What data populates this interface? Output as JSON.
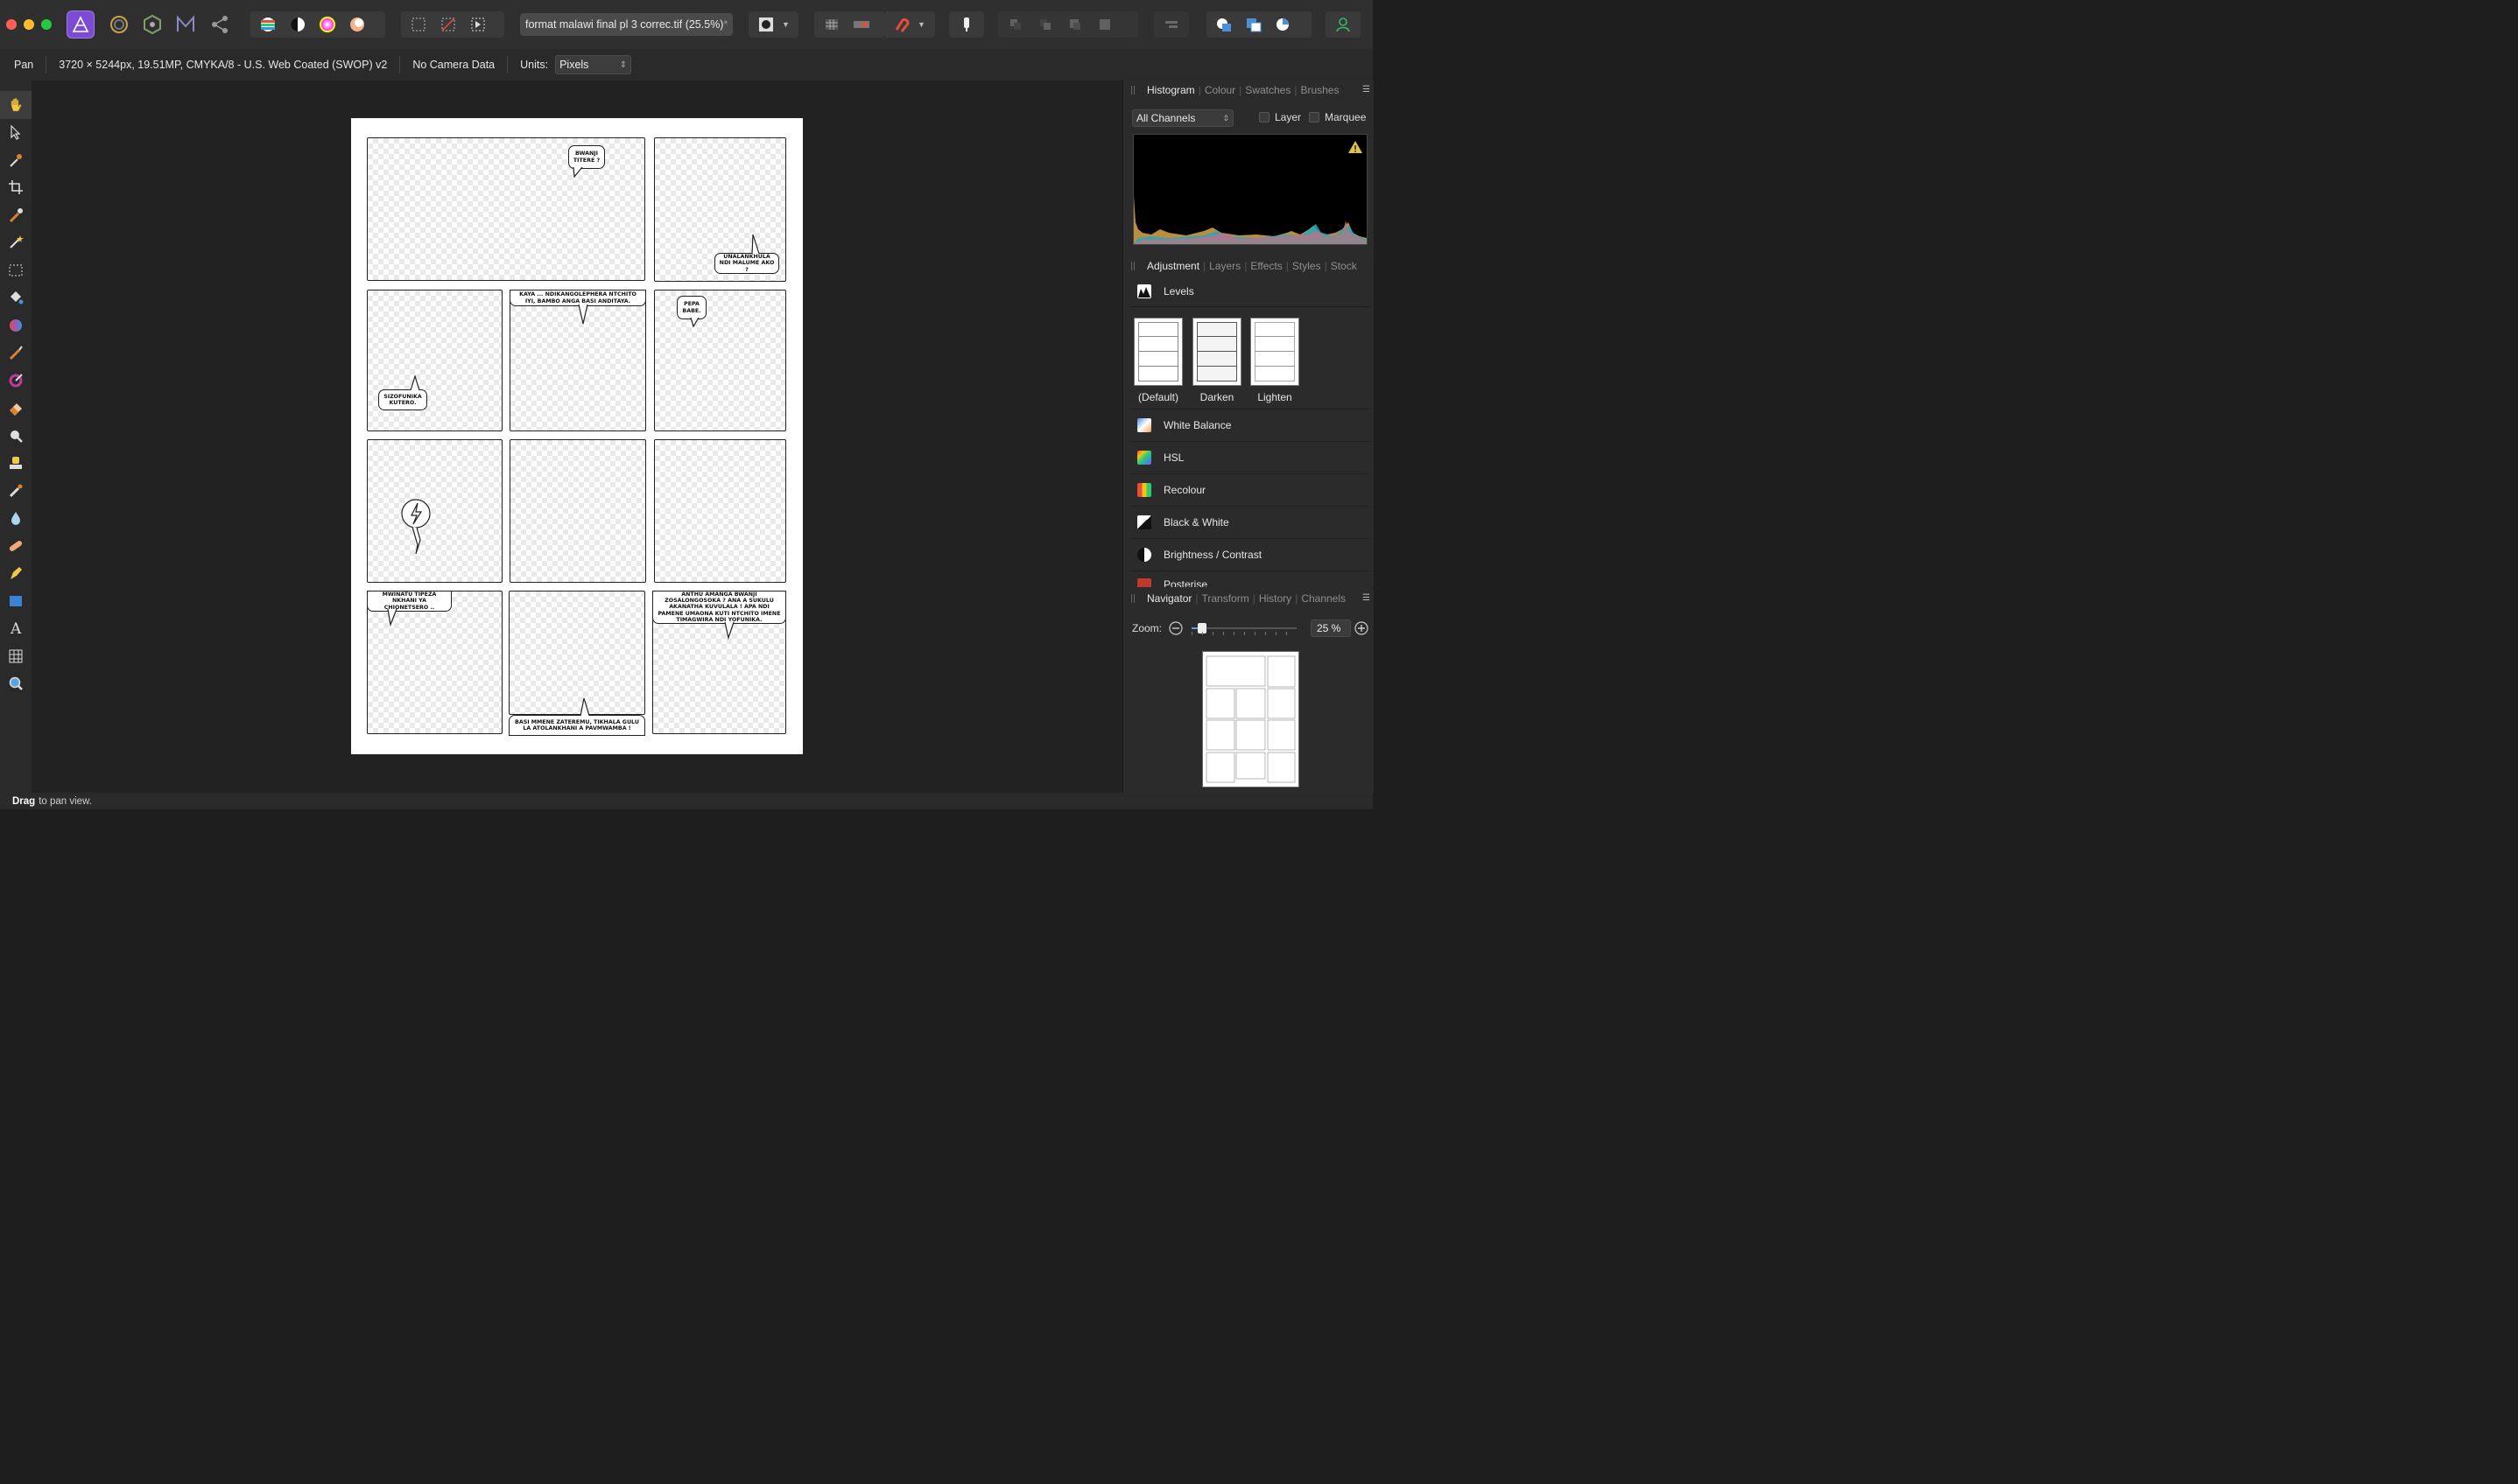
{
  "toolbar": {
    "document_tab": "format malawi final pl 3 correc.tif (25.5%)",
    "document_modified_mark": "*"
  },
  "contextbar": {
    "tool_name": "Pan",
    "doc_info": "3720 × 5244px, 19.51MP, CMYKA/8 - U.S. Web Coated (SWOP) v2",
    "camera": "No Camera Data",
    "units_label": "Units:",
    "units_value": "Pixels"
  },
  "comic": {
    "bubble1": "BWANJI TITERE ?",
    "bubble2": "UNALANKHULA NDI MALUME AKO ?",
    "bubble3": "KAYA ... NDIKANGOLEPHERA NTCHITO IYI, BAMBO ANGA BASI ANDITAYA.",
    "bubble4": "PEPA BABE.",
    "bubble5": "SIZOFUNIKA KUTERO.",
    "bubble6": "MWINATU TIPEZA NKHANI YA CHIONETSERO ..",
    "bubble7": "ANTHU AMANGA BWANJI ZOSALONGOSOKA ? ANA A SUKULU AKANATHA KUVULALA ! APA NDI PAMENE UMAONA KUTI NTCHITO IMENE TIMAGWIRA NDI YOFUNIKA.",
    "bubble8": "BASI MMENE ZATEREMU, TIKHALA GULU LA ATOLANKHANI A PAVMWAMBA !"
  },
  "histogram_panel": {
    "tabs": [
      "Histogram",
      "Colour",
      "Swatches",
      "Brushes"
    ],
    "channels_value": "All Channels",
    "layer_label": "Layer",
    "marquee_label": "Marquee"
  },
  "adjustment_panel": {
    "tabs": [
      "Adjustment",
      "Layers",
      "Effects",
      "Styles",
      "Stock"
    ],
    "levels_title": "Levels",
    "presets": [
      "(Default)",
      "Darken",
      "Lighten"
    ],
    "items": [
      "White Balance",
      "HSL",
      "Recolour",
      "Black & White",
      "Brightness / Contrast",
      "Posterise"
    ]
  },
  "navigator_panel": {
    "tabs": [
      "Navigator",
      "Transform",
      "History",
      "Channels"
    ],
    "zoom_label": "Zoom:",
    "zoom_value": "25 %",
    "zoom_level": 0.25
  },
  "status": {
    "bold": "Drag",
    "text": "to pan view."
  }
}
